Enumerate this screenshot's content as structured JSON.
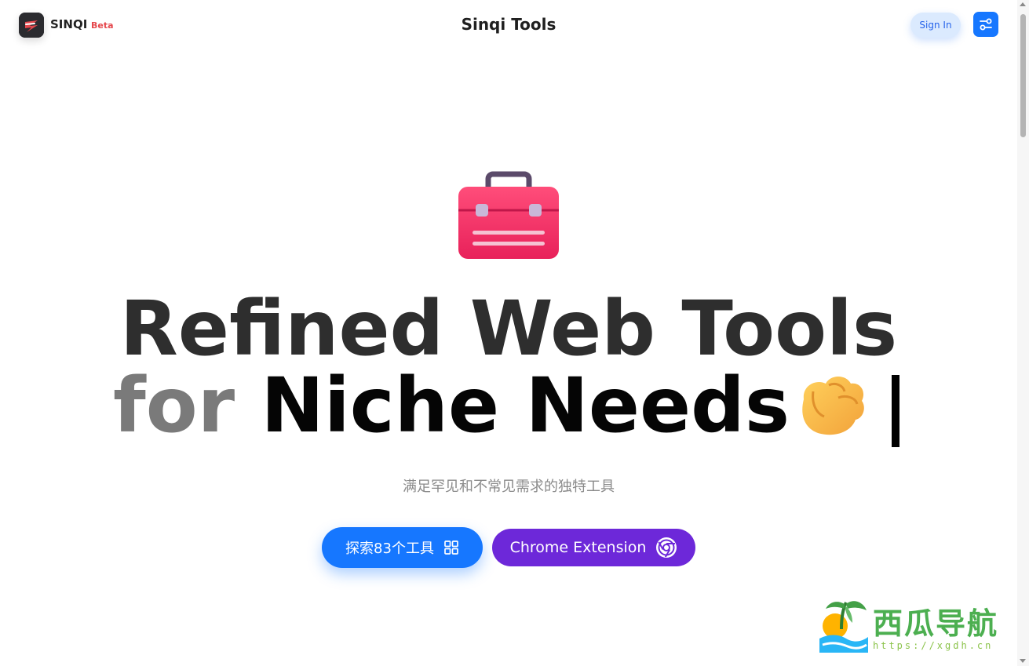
{
  "header": {
    "brand": "SINQI",
    "badge": "Beta",
    "title": "Sinqi Tools",
    "sign_in": "Sign In"
  },
  "hero": {
    "line1": "Refined Web Tools",
    "line2_muted": "for",
    "line2_strong": "Niche Needs",
    "subtitle": "满足罕见和不常见需求的独特工具",
    "explore_button": "探索83个工具",
    "chrome_button": "Chrome Extension"
  },
  "watermark": {
    "text": "西瓜导航",
    "url": "https://xgdh.cn"
  },
  "icons": {
    "logo": "sinqi-logo-icon",
    "settings": "settings-sliders-icon",
    "toolbox": "toolbox-icon",
    "fist": "raised-fist-emoji-icon",
    "grid": "grid-icon",
    "chrome": "chrome-icon"
  },
  "colors": {
    "primary": "#1677ff",
    "chrome_button": "#6d28d9",
    "beta": "#e5484d",
    "toolbox": "#f43f6e"
  }
}
